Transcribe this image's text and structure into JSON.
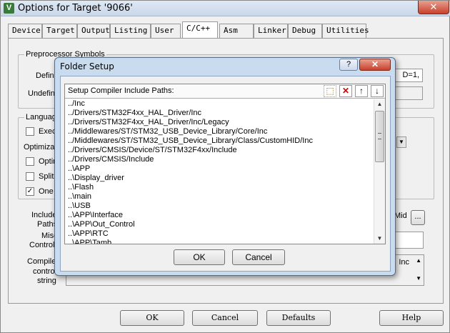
{
  "window": {
    "title": "Options for Target '9066'",
    "icon_letter": "V",
    "close_glyph": "✕"
  },
  "tabs": [
    {
      "label": "Device"
    },
    {
      "label": "Target"
    },
    {
      "label": "Output"
    },
    {
      "label": "Listing"
    },
    {
      "label": "User"
    },
    {
      "label": "C/C++",
      "active": true
    },
    {
      "label": "Asm"
    },
    {
      "label": "Linker"
    },
    {
      "label": "Debug"
    },
    {
      "label": "Utilities"
    }
  ],
  "background_panel": {
    "preprocessor_group": "Preprocessor Symbols",
    "define_label": "Defin",
    "define_value_tail": "D=1,",
    "undefine_label": "Undefin",
    "language_group": "Languag",
    "exec_label": "Exec",
    "optimization_label": "Optimizat",
    "optim_label": "Optir",
    "split_label": "Split",
    "one_label": "One",
    "one_checked": "✓",
    "include_label": "Include",
    "paths_label": "Paths",
    "misc_label": "Misc",
    "controls_label": "Controls",
    "compiler_label": "Compile",
    "control_label": "contro",
    "string_label": "string",
    "mid_label": "Mid",
    "browse_button": "...",
    "inc_label": "Inc"
  },
  "bottom_buttons": {
    "ok": "OK",
    "cancel": "Cancel",
    "defaults": "Defaults",
    "help": "Help"
  },
  "dialog": {
    "title": "Folder Setup",
    "help_glyph": "?",
    "close_glyph": "✕",
    "paths_header": "Setup Compiler Include Paths:",
    "toolbar_icons": [
      "new-folder-icon",
      "delete-icon",
      "move-up-icon",
      "move-down-icon"
    ],
    "toolbar_glyphs": [
      "⬚",
      "✕",
      "↑",
      "↓"
    ],
    "paths": [
      "../Inc",
      "../Drivers/STM32F4xx_HAL_Driver/Inc",
      "../Drivers/STM32F4xx_HAL_Driver/Inc/Legacy",
      "../Middlewares/ST/STM32_USB_Device_Library/Core/Inc",
      "../Middlewares/ST/STM32_USB_Device_Library/Class/CustomHID/Inc",
      "../Drivers/CMSIS/Device/ST/STM32F4xx/Include",
      "../Drivers/CMSIS/Include",
      "..\\APP",
      "..\\Display_driver",
      "..\\Flash",
      "..\\main",
      "..\\USB",
      "..\\APP\\Interface",
      "..\\APP\\Out_Control",
      "..\\APP\\RTC",
      "..\\APP\\Tamb"
    ],
    "ok": "OK",
    "cancel": "Cancel"
  }
}
